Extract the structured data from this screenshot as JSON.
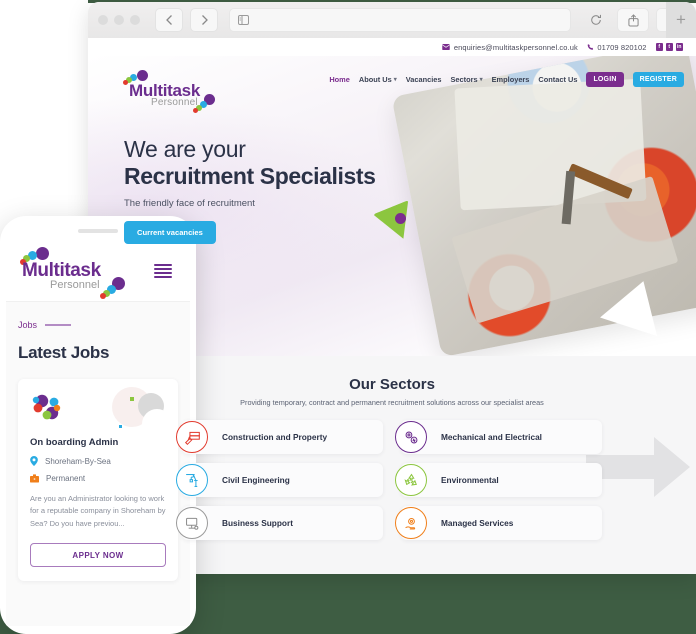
{
  "browser": {
    "back_icon": "chevron-left-icon",
    "forward_icon": "chevron-right-icon",
    "sidebar_icon": "sidebar-icon",
    "url_value": "",
    "url_placeholder": "",
    "reload_icon": "reload-icon",
    "share_icon": "share-icon",
    "tabs_icon": "tabs-icon",
    "new_tab_label": "+"
  },
  "site": {
    "topbar": {
      "email": "enquiries@multitaskpersonnel.co.uk",
      "phone": "01709 820102",
      "email_icon": "envelope-icon",
      "phone_icon": "phone-icon",
      "social": [
        {
          "name": "facebook-icon",
          "glyph": "f"
        },
        {
          "name": "twitter-icon",
          "glyph": "t"
        },
        {
          "name": "linkedin-icon",
          "glyph": "in"
        }
      ]
    },
    "logo": {
      "title": "Multitask",
      "subtitle": "Personnel"
    },
    "nav": [
      {
        "label": "Home",
        "active": true,
        "caret": false
      },
      {
        "label": "About Us",
        "active": false,
        "caret": true
      },
      {
        "label": "Vacancies",
        "active": false,
        "caret": false
      },
      {
        "label": "Sectors",
        "active": false,
        "caret": true
      },
      {
        "label": "Employers",
        "active": false,
        "caret": false
      },
      {
        "label": "Contact Us",
        "active": false,
        "caret": false
      }
    ],
    "login_label": "LOGIN",
    "register_label": "REGISTER",
    "hero": {
      "line1": "We are your",
      "line2": "Recruitment Specialists",
      "subtitle": "The friendly face of recruitment",
      "cta_label": "Current vacancies"
    },
    "sectors": {
      "title": "Our Sectors",
      "subtitle": "Providing temporary, contract and permanent recruitment solutions across our specialist areas",
      "items": [
        {
          "label": "Construction and Property",
          "icon": "trowel-brick-icon",
          "color": "#e23b2e"
        },
        {
          "label": "Mechanical and Electrical",
          "icon": "gears-bolt-icon",
          "color": "#6b2d8e"
        },
        {
          "label": "Civil Engineering",
          "icon": "crane-icon",
          "color": "#29abe2"
        },
        {
          "label": "Environmental",
          "icon": "recycle-icon",
          "color": "#8cc63f"
        },
        {
          "label": "Business Support",
          "icon": "computer-icon",
          "color": "#8d8d8d"
        },
        {
          "label": "Managed Services",
          "icon": "gear-hand-icon",
          "color": "#f07f1a"
        }
      ]
    }
  },
  "phone": {
    "logo": {
      "title": "Multitask",
      "subtitle": "Personnel"
    },
    "menu_icon": "hamburger-menu-icon",
    "breadcrumb": "Jobs",
    "heading": "Latest Jobs",
    "job": {
      "title": "On boarding Admin",
      "location": "Shoreham-By-Sea",
      "location_icon": "map-pin-icon",
      "type": "Permanent",
      "type_icon": "briefcase-icon",
      "description": "Are you an Administrator looking to work for a reputable company in Shoreham by Sea? Do you have previou...",
      "apply_label": "APPLY NOW"
    }
  },
  "colors": {
    "brand_purple": "#7b2d8e",
    "brand_blue": "#29abe2",
    "brand_green": "#8cc63f",
    "brand_orange": "#f07f1a",
    "brand_red": "#e23b2e",
    "backdrop_green": "#3e5d43",
    "text_dark": "#2b3247"
  }
}
